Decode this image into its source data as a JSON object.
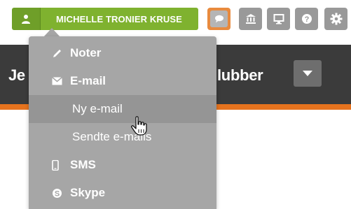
{
  "toolbar": {
    "user_name": "MICHELLE TRONIER KRUSE",
    "buttons": [
      {
        "icon": "chat-bubble-icon",
        "state": "active"
      },
      {
        "icon": "bank-icon"
      },
      {
        "icon": "monitor-icon"
      },
      {
        "icon": "help-icon"
      },
      {
        "icon": "gear-icon"
      }
    ]
  },
  "header": {
    "left_fragment": "Je",
    "right_fragment": "lubber"
  },
  "menu": {
    "items": [
      {
        "label": "Noter",
        "icon": "pencil-icon",
        "kind": "heading"
      },
      {
        "label": "E-mail",
        "icon": "envelope-icon",
        "kind": "heading"
      },
      {
        "label": "Ny e-mail",
        "kind": "sub",
        "hovered": true
      },
      {
        "label": "Sendte e-mails",
        "kind": "sub"
      },
      {
        "label": "SMS",
        "icon": "phone-icon",
        "kind": "heading"
      },
      {
        "label": "Skype",
        "icon": "skype-icon",
        "kind": "heading"
      }
    ]
  },
  "colors": {
    "user_green": "#7fb22f",
    "active_orange": "#e88a3e",
    "header_dark": "#3b3b3b",
    "header_accent": "#e6731e",
    "menu_bg": "#a6a6a6"
  }
}
